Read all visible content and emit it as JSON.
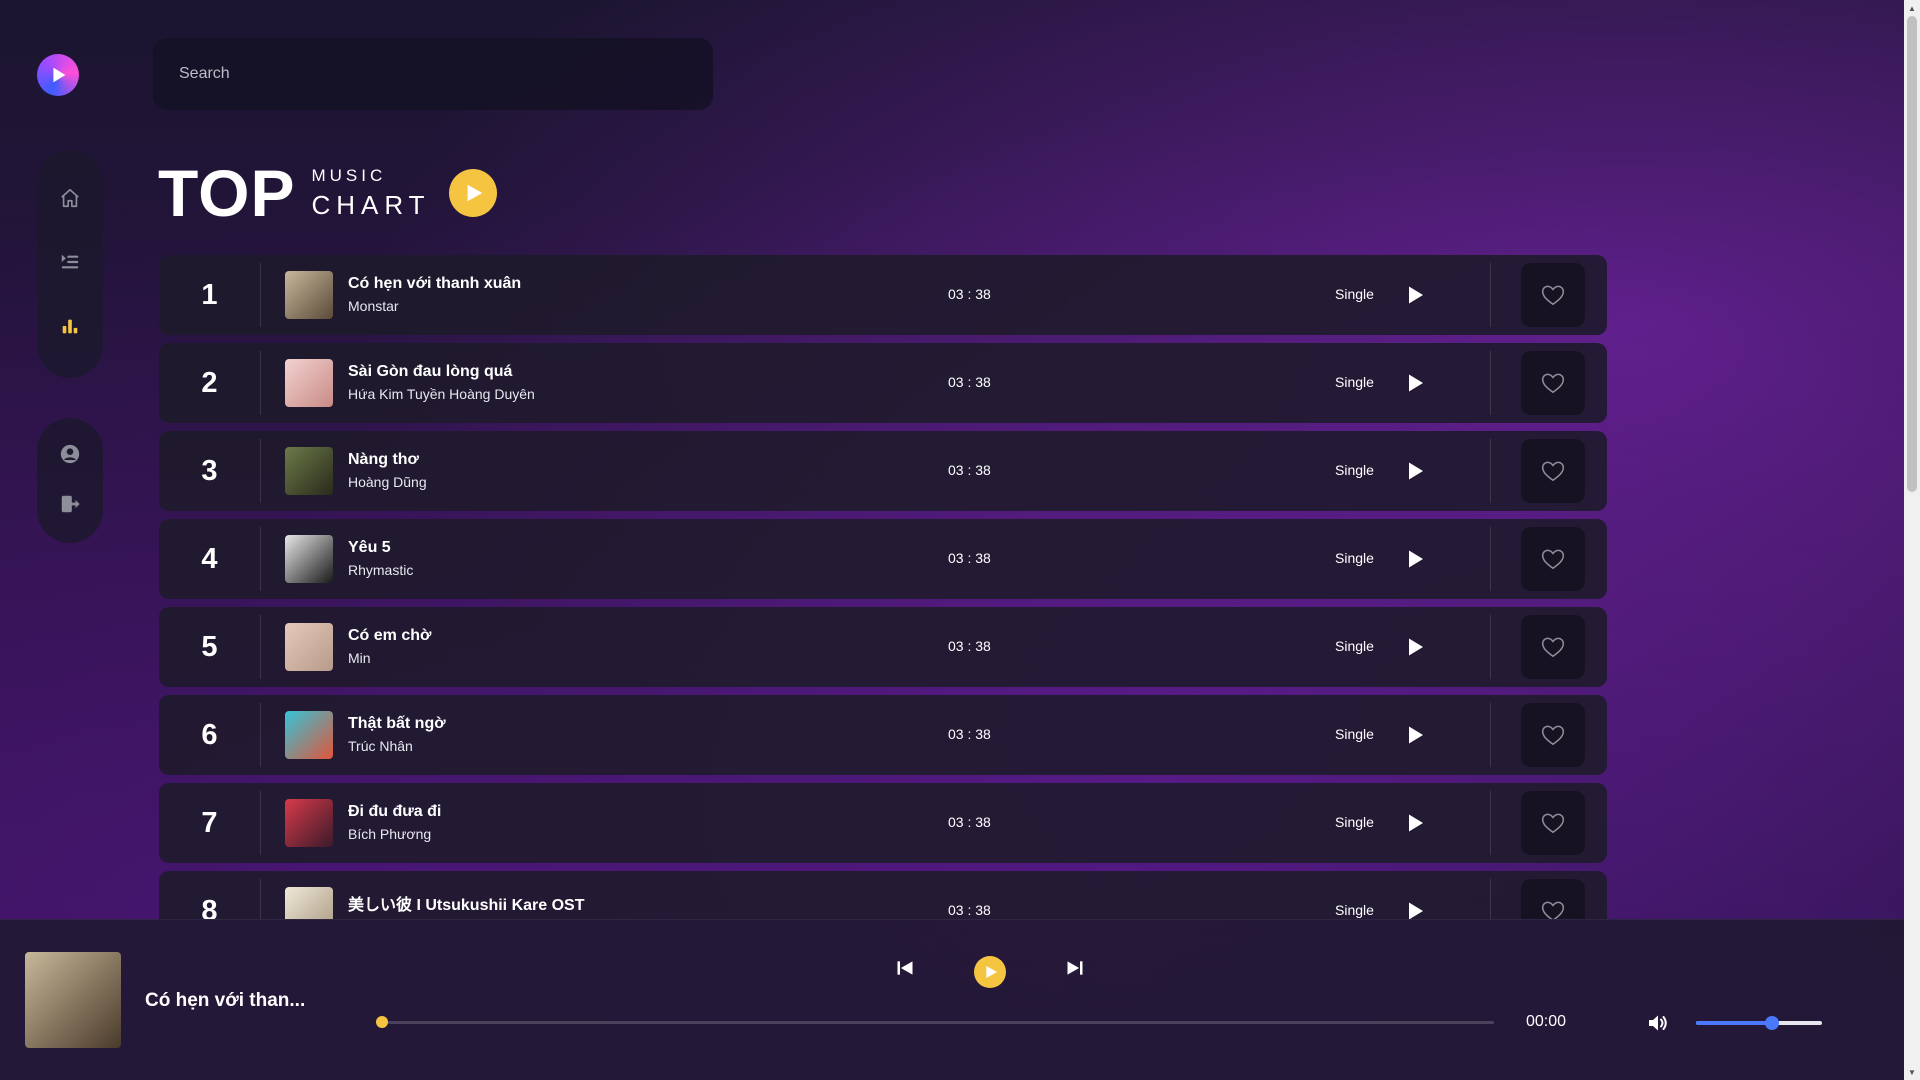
{
  "app": {
    "logo_icon": "play-logo-icon"
  },
  "search": {
    "placeholder": "Search",
    "value": ""
  },
  "sidebar": {
    "nav_items": [
      {
        "icon": "home-icon",
        "active": false
      },
      {
        "icon": "playlist-icon",
        "active": false
      },
      {
        "icon": "chart-icon",
        "active": true
      }
    ],
    "account_items": [
      {
        "icon": "user-icon"
      },
      {
        "icon": "logout-icon"
      }
    ]
  },
  "heading": {
    "top": "TOP",
    "music": "MUSIC",
    "chart": "CHART"
  },
  "songs": [
    {
      "rank": "1",
      "title": "Có hẹn với thanh xuân",
      "artist": "Monstar",
      "duration": "03 : 38",
      "type": "Single",
      "thumb_colors": [
        "#c8b89a",
        "#5a4a3a"
      ]
    },
    {
      "rank": "2",
      "title": "Sài Gòn đau lòng quá",
      "artist": "Hứa Kim Tuyền Hoàng Duyên",
      "duration": "03 : 38",
      "type": "Single",
      "thumb_colors": [
        "#f2d2d0",
        "#c98a86"
      ]
    },
    {
      "rank": "3",
      "title": "Nàng thơ",
      "artist": "Hoàng Dũng",
      "duration": "03 : 38",
      "type": "Single",
      "thumb_colors": [
        "#6b7a4a",
        "#2a2a1a"
      ]
    },
    {
      "rank": "4",
      "title": "Yêu 5",
      "artist": "Rhymastic",
      "duration": "03 : 38",
      "type": "Single",
      "thumb_colors": [
        "#e8e8e8",
        "#1a1a1a"
      ]
    },
    {
      "rank": "5",
      "title": "Có em chờ",
      "artist": "Min",
      "duration": "03 : 38",
      "type": "Single",
      "thumb_colors": [
        "#e6c9b8",
        "#b89a8a"
      ]
    },
    {
      "rank": "6",
      "title": "Thật bất ngờ",
      "artist": "Trúc Nhân",
      "duration": "03 : 38",
      "type": "Single",
      "thumb_colors": [
        "#35c4d8",
        "#e0553a"
      ]
    },
    {
      "rank": "7",
      "title": "Đi đu đưa đi",
      "artist": "Bích Phương",
      "duration": "03 : 38",
      "type": "Single",
      "thumb_colors": [
        "#d83a4a",
        "#3a1a2a"
      ]
    },
    {
      "rank": "8",
      "title": "美しい彼 I Utsukushii Kare OST",
      "artist": "",
      "duration": "03 : 38",
      "type": "Single",
      "thumb_colors": [
        "#f0e8d8",
        "#a89880"
      ]
    }
  ],
  "player": {
    "title": "Có hẹn với than...",
    "current_time": "00:00",
    "progress": 0,
    "volume": 0.6,
    "thumb_colors": [
      "#c8b89a",
      "#4a3a2a"
    ]
  },
  "colors": {
    "accent": "#f5c542",
    "volume": "#4a79ff"
  }
}
